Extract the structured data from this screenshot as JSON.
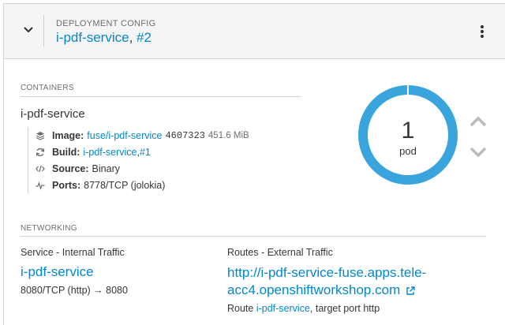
{
  "header": {
    "kind_label": "DEPLOYMENT CONFIG",
    "name": "i-pdf-service",
    "separator": ", ",
    "revision": "#2"
  },
  "containers": {
    "section_label": "CONTAINERS",
    "container_name": "i-pdf-service",
    "image": {
      "label": "Image:",
      "name": "fuse/i-pdf-service",
      "id": "4607323",
      "size": "451.6 MiB"
    },
    "build": {
      "label": "Build:",
      "name": "i-pdf-service",
      "separator": ", ",
      "number": "#1"
    },
    "source": {
      "label": "Source:",
      "value": "Binary"
    },
    "ports": {
      "label": "Ports:",
      "value": "8778/TCP (jolokia)"
    }
  },
  "pods": {
    "count": "1",
    "label": "pod"
  },
  "networking": {
    "section_label": "NETWORKING",
    "service_heading": "Service - Internal Traffic",
    "service_name": "i-pdf-service",
    "port_mapping": "8080/TCP (http) → 8080",
    "routes_heading": "Routes - External Traffic",
    "route_url": "http://i-pdf-service-fuse.apps.tele-acc4.openshiftworkshop.com",
    "route_prefix": "Route ",
    "route_service": "i-pdf-service",
    "route_suffix": ", target port http"
  },
  "colors": {
    "accent": "#0088ce",
    "donut": "#39a5dc",
    "header_bg": "#f5f5f5",
    "scale_arrow": "#bbbbbb"
  },
  "icons": {
    "collapse": "chevron-down-icon",
    "menu": "kebab-icon",
    "image": "layers-icon",
    "build": "refresh-icon",
    "source": "code-icon",
    "ports": "pulse-icon",
    "scale_up": "chevron-up-icon",
    "scale_down": "chevron-down-icon",
    "external": "external-link-icon"
  }
}
